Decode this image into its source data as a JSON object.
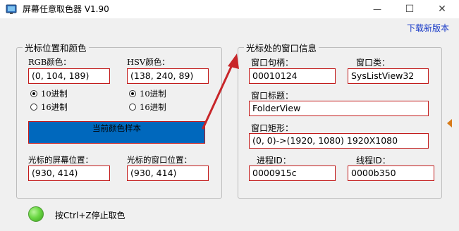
{
  "window": {
    "title": "屏幕任意取色器 V1.90",
    "min_glyph": "—",
    "max_glyph": "☐",
    "close_glyph": "✕"
  },
  "menu": {
    "download_link": "下载新版本"
  },
  "left_group": {
    "legend": "光标位置和颜色",
    "rgb_label": "RGB颜色：",
    "rgb_value": "(0, 104, 189)",
    "hsv_label": "HSV颜色：",
    "hsv_value": "(138, 240, 89)",
    "rgb_radix": [
      {
        "label": "10进制",
        "checked": true
      },
      {
        "label": "16进制",
        "checked": false
      }
    ],
    "hsv_radix": [
      {
        "label": "10进制",
        "checked": true
      },
      {
        "label": "16进制",
        "checked": false
      }
    ],
    "sample_label": "当前颜色样本",
    "sample_color": "#0068bd",
    "screen_pos_label": "光标的屏幕位置：",
    "screen_pos_value": "(930, 414)",
    "window_pos_label": "光标的窗口位置：",
    "window_pos_value": "(930, 414)"
  },
  "right_group": {
    "legend": "光标处的窗口信息",
    "handle_label": "窗口句柄：",
    "handle_value": "00010124",
    "class_label": "窗口类：",
    "class_value": "SysListView32",
    "title_label": "窗口标题：",
    "title_value": "FolderView",
    "rect_label": "窗口矩形：",
    "rect_value": "(0, 0)->(1920, 1080) 1920X1080",
    "pid_label": "进程ID：",
    "pid_value": "0000915c",
    "tid_label": "线程ID：",
    "tid_value": "0000b350"
  },
  "status": {
    "text": "按Ctrl+Z停止取色",
    "led_color": "#6cd845"
  },
  "colors": {
    "field_border": "#c21a1a",
    "link": "#1a3cc8",
    "annotation_arrow": "#c8262a",
    "side_arrow": "#d87b1a"
  },
  "icons": [
    "app-icon",
    "minimize-icon",
    "maximize-icon",
    "close-icon",
    "status-led-icon",
    "side-arrow-icon",
    "annotation-arrow"
  ]
}
